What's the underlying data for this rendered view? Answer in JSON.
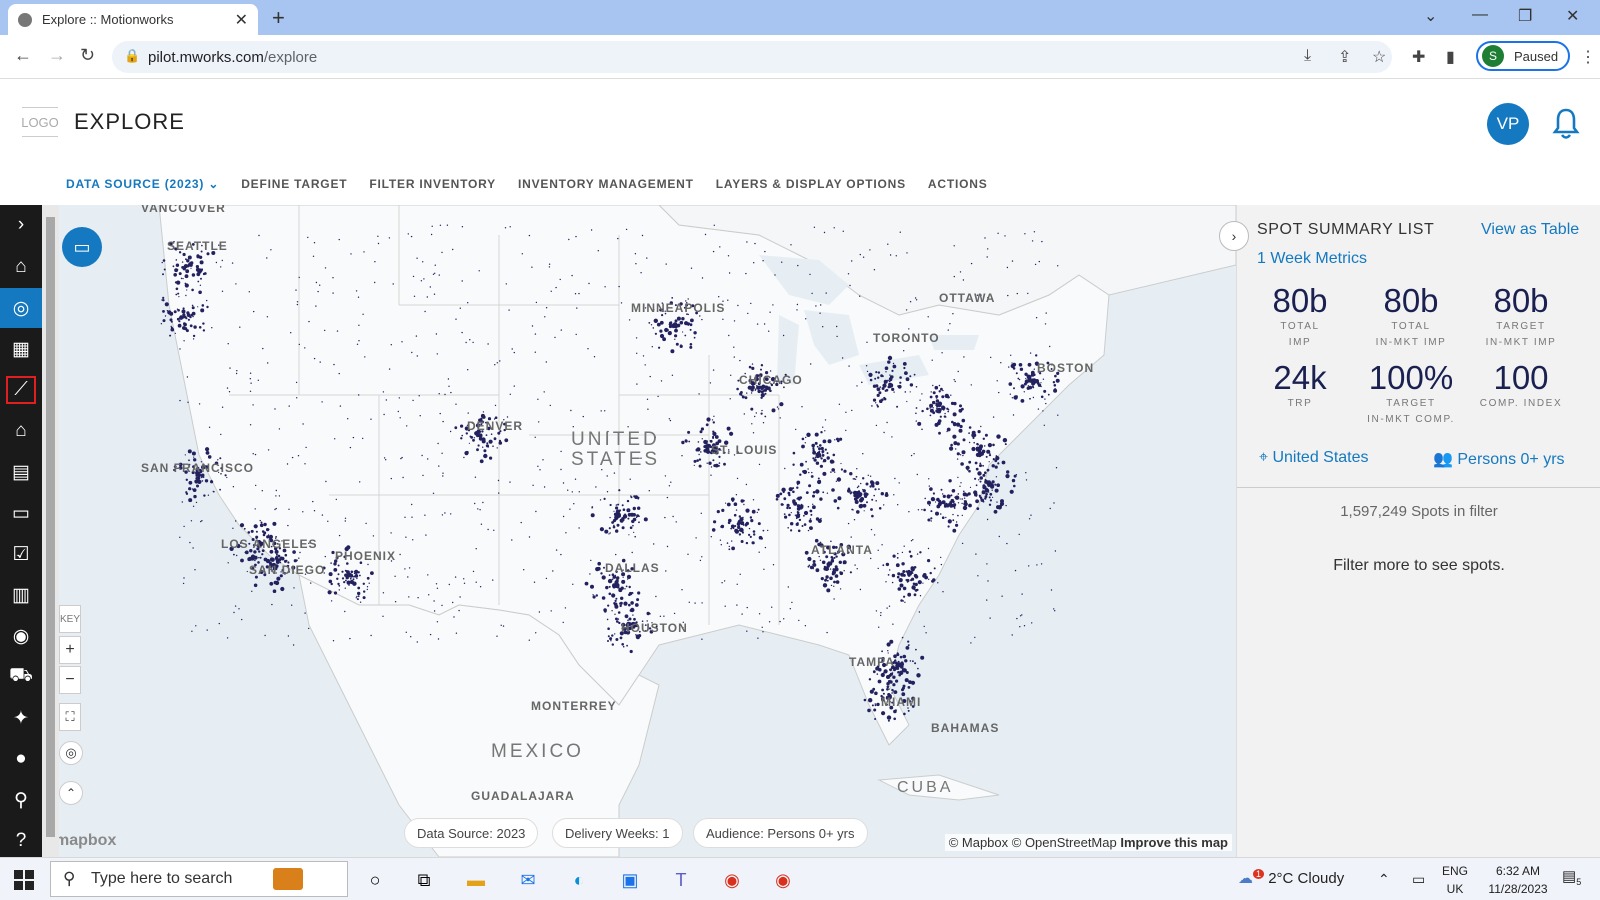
{
  "browser": {
    "tab_title": "Explore :: Motionworks",
    "url_host": "pilot.mworks.com",
    "url_path": "/explore",
    "profile_initial": "S",
    "profile_status": "Paused"
  },
  "header": {
    "logo_text": "LOGO",
    "page_title": "EXPLORE",
    "user_initials": "VP"
  },
  "menu": {
    "items": [
      {
        "label": "DATA SOURCE (2023)"
      },
      {
        "label": "DEFINE TARGET"
      },
      {
        "label": "FILTER INVENTORY"
      },
      {
        "label": "INVENTORY MANAGEMENT"
      },
      {
        "label": "LAYERS & DISPLAY OPTIONS"
      },
      {
        "label": "ACTIONS"
      }
    ]
  },
  "map": {
    "labels": {
      "vancouver": "VANCOUVER",
      "seattle": "SEATTLE",
      "minneapolis": "MINNEAPOLIS",
      "ottawa": "OTTAWA",
      "toronto": "TORONTO",
      "chicago": "CHICAGO",
      "boston": "BOSTON",
      "denver": "DENVER",
      "united": "UNITED",
      "states": "STATES",
      "st_louis": "ST. LOUIS",
      "san_francisco": "SAN FRANCISCO",
      "los_angeles": "LOS ANGELES",
      "san_diego": "SAN DIEGO",
      "phoenix": "PHOENIX",
      "atlanta": "ATLANTA",
      "dallas": "DALLAS",
      "houston": "HOUSTON",
      "tampa": "TAMPA",
      "miami": "MIAMI",
      "bahamas": "BAHAMAS",
      "monterrey": "MONTERREY",
      "mexico": "MEXICO",
      "guadalajara": "GUADALAJARA",
      "cuba": "CUBA"
    },
    "key_label": "KEY",
    "zoom_in": "+",
    "zoom_out": "−",
    "mapbox_logo": "mapbox",
    "attribution": "© Mapbox © OpenStreetMap",
    "improve_link": "Improve this map",
    "chips": {
      "data_source": "Data Source: 2023",
      "delivery_weeks": "Delivery Weeks: 1",
      "audience": "Audience: Persons 0+ yrs"
    }
  },
  "panel": {
    "title": "SPOT SUMMARY LIST",
    "view_as_table": "View as Table",
    "week_metrics": "1 Week Metrics",
    "metrics": [
      {
        "value": "80b",
        "label1": "TOTAL",
        "label2": "IMP"
      },
      {
        "value": "80b",
        "label1": "TOTAL",
        "label2": "IN-MKT IMP"
      },
      {
        "value": "80b",
        "label1": "TARGET",
        "label2": "IN-MKT IMP"
      },
      {
        "value": "24k",
        "label1": "TRP",
        "label2": ""
      },
      {
        "value": "100%",
        "label1": "TARGET",
        "label2": "IN-MKT COMP."
      },
      {
        "value": "100",
        "label1": "COMP. INDEX",
        "label2": ""
      }
    ],
    "location": "United States",
    "audience": "Persons 0+ yrs",
    "spots_count": "1,597,249 Spots in filter",
    "filter_message": "Filter more to see spots."
  },
  "taskbar": {
    "search_placeholder": "Type here to search",
    "weather": "2°C  Cloudy",
    "weather_badge": "1",
    "lang1": "ENG",
    "lang2": "UK",
    "time": "6:32 AM",
    "date": "11/28/2023",
    "notif_count": "5"
  }
}
